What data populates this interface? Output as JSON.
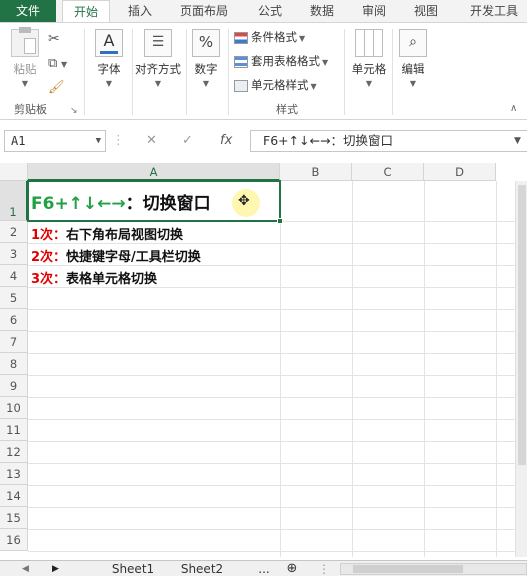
{
  "ribbon_tabs": [
    "文件",
    "开始",
    "插入",
    "页面布局",
    "公式",
    "数据",
    "审阅",
    "视图",
    "开发工具"
  ],
  "active_tab": "开始",
  "clipboard": {
    "paste_label": "粘贴",
    "group_label": "剪贴板"
  },
  "font_group": {
    "label": "字体"
  },
  "align_group": {
    "label": "对齐方式"
  },
  "number_group": {
    "label": "数字",
    "icon_text": "%"
  },
  "styles_group": {
    "conditional_format": "条件格式",
    "table_format": "套用表格格式",
    "cell_styles": "单元格样式",
    "label": "样式"
  },
  "cells_group": {
    "label": "单元格"
  },
  "edit_group": {
    "label": "编辑"
  },
  "formula_bar": {
    "name_box": "A1",
    "fx": "fx",
    "formula": "F6+↑↓←→：切换窗口"
  },
  "columns": [
    "A",
    "B",
    "C",
    "D"
  ],
  "rows": [
    "1",
    "2",
    "3",
    "4",
    "5",
    "6",
    "7",
    "8",
    "9",
    "10",
    "11",
    "12",
    "13",
    "14",
    "15",
    "16"
  ],
  "cells": {
    "a1_prefix": "F6+↑↓←→",
    "a1_suffix": "：切换窗口",
    "a2_num": "1次：",
    "a2_text": "右下角布局视图切换",
    "a3_num": "2次：",
    "a3_text": "快捷键字母/工具栏切换",
    "a4_num": "3次：",
    "a4_text": "表格单元格切换"
  },
  "sheets": [
    "Sheet1",
    "Sheet2",
    "..."
  ],
  "colors": {
    "accent": "#217346",
    "red": "#e00000",
    "green": "#21a044"
  }
}
